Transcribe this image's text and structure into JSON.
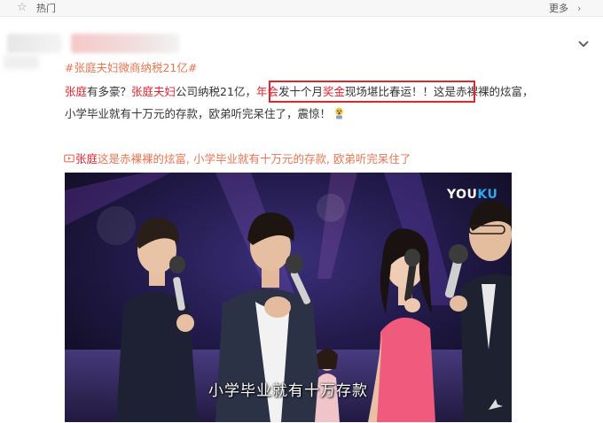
{
  "topbar": {
    "star_icon": "star-icon",
    "title": "热门",
    "more_label": "更多",
    "more_icon": "chevron-right-icon"
  },
  "post": {
    "hashtag": "#张庭夫妇微商纳税21亿#",
    "line1": {
      "p1": "张庭",
      "p2": "有多豪？",
      "p3": "张庭夫妇",
      "p4": "公司纳税21亿，",
      "p5": "年会",
      "p6": "发十个月",
      "p7": "奖金",
      "p8": "现场堪比春运！！",
      "p9": "这是赤裸裸的炫富，"
    },
    "line2": "小学毕业就有十万元的存款，欧弟听完呆住了，震惊！",
    "video_link": {
      "p1": "张庭",
      "p2": "这是赤裸裸的炫富, 小学毕业就有十万元的存款, 欧弟听完呆住了"
    }
  },
  "video": {
    "logo_left": "YOU",
    "logo_right": "KU",
    "subtitle": "小学毕业就有十万存款"
  },
  "colors": {
    "accent_orange": "#eb7350",
    "highlight_red": "#e0212b",
    "box_red": "#d9282e"
  }
}
